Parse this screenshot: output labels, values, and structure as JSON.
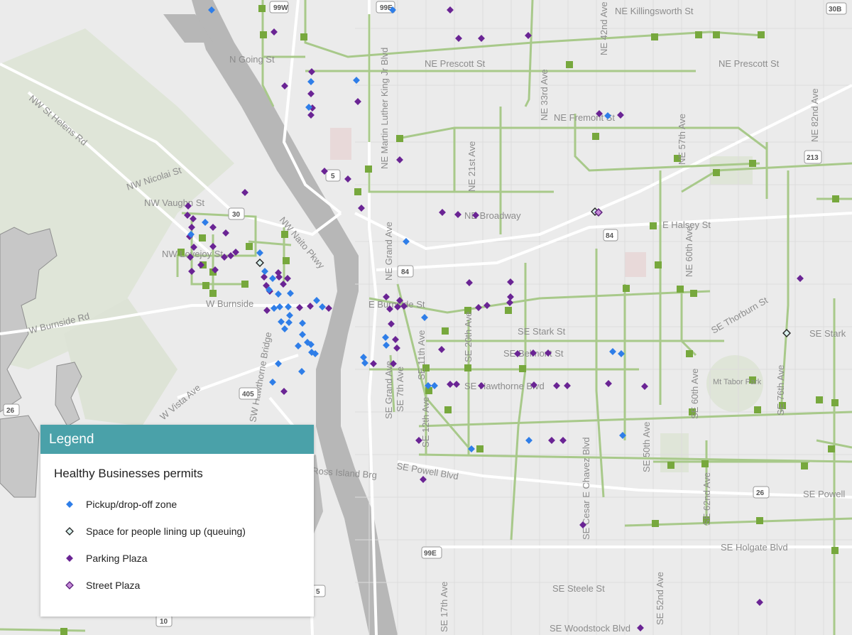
{
  "legend": {
    "title": "Legend",
    "subtitle": "Healthy Businesses permits",
    "items": [
      {
        "label": "Pickup/drop-off zone",
        "symbol": "blue-diamond-icon",
        "color": "#2f7ee8"
      },
      {
        "label": "Space for people lining up (queuing)",
        "symbol": "outlined-diamond-icon",
        "color": "#d9f0ee"
      },
      {
        "label": "Parking Plaza",
        "symbol": "purple-diamond-icon",
        "color": "#6a2494"
      },
      {
        "label": "Street Plaza",
        "symbol": "pink-diamond-icon",
        "color": "#c58ad8"
      }
    ]
  },
  "map": {
    "colors": {
      "water": "#b7b7b7",
      "land": "#ebebeb",
      "park": "#dfe5d8",
      "bikeway": "#a8c98a",
      "bikeway_marker": "#77a83d",
      "major_road": "#ffffff",
      "boundary": "#8f8f8f"
    },
    "street_labels": [
      "NE Killingsworth St",
      "N Going St",
      "NE Prescott St",
      "NE Prescott St",
      "NE Fremont St",
      "NW St Helens Rd",
      "NW Nicolai St",
      "NW Vaughn St",
      "NW Naito Pkwy",
      "NE Broadway",
      "E Halsey St",
      "W Burnside Rd",
      "W Burnside",
      "E Burnside St",
      "SE Stark St",
      "SE Belmont St",
      "SE Hawthorne Blvd",
      "Mt Tabor Park",
      "Ross Island Brg",
      "SE Powell Blvd",
      "SE Powell",
      "SE Holgate Blvd",
      "SE Steele St",
      "SE Woodstock Blvd",
      "NE Martin Luther King Jr Blvd",
      "NE Grand Ave",
      "NE 21st Ave",
      "NE 33rd Ave",
      "NE 42nd Ave",
      "NE 57th Ave",
      "NE 82nd Ave",
      "NE 60th Ave",
      "SE 60th Ave",
      "SE 76th Ave",
      "SE 50th Ave",
      "SE 52nd Ave",
      "SE 62nd Ave",
      "SE Cesar E Chavez Blvd",
      "SE 12th Ave",
      "SE 20th Ave",
      "SE 11th Ave",
      "SE 7th Ave",
      "SE Grand Ave",
      "SE 17th Ave",
      "SE Thorburn St",
      "SE Stark",
      "W Vista Ave",
      "NW Lovejoy St",
      "SW Hawthorne Bridge"
    ],
    "highway_shields": [
      "99W",
      "99E",
      "30B",
      "213",
      "30",
      "84",
      "5",
      "405",
      "26",
      "26",
      "99E",
      "10",
      "5",
      "84"
    ]
  }
}
